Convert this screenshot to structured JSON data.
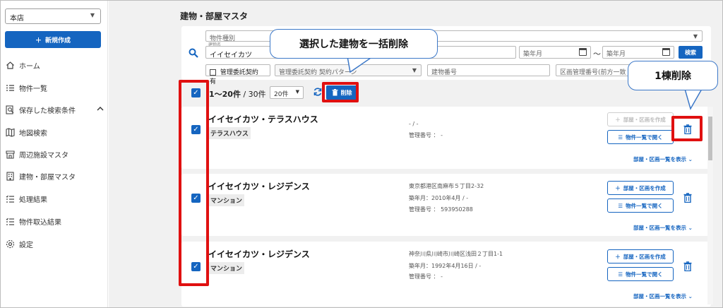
{
  "sidebar": {
    "store": "本店",
    "new_button": "新規作成",
    "items": [
      {
        "label": "ホーム",
        "icon": "home-icon"
      },
      {
        "label": "物件一覧",
        "icon": "list-icon"
      },
      {
        "label": "保存した検索条件",
        "icon": "saved-search-icon"
      },
      {
        "label": "地図検索",
        "icon": "map-icon"
      },
      {
        "label": "周辺施設マスタ",
        "icon": "store-icon"
      },
      {
        "label": "建物・部屋マスタ",
        "icon": "building-icon"
      },
      {
        "label": "処理結果",
        "icon": "checklist-icon"
      },
      {
        "label": "物件取込結果",
        "icon": "checklist-icon"
      },
      {
        "label": "設定",
        "icon": "gear-icon"
      }
    ]
  },
  "page": {
    "title": "建物・部屋マスタ"
  },
  "search": {
    "property_type_placeholder": "物件種別",
    "building_name_label": "建物名",
    "building_name_value": "イイセイカツ",
    "built_from_placeholder": "築年月",
    "range_sep": "〜",
    "built_to_placeholder": "築年月",
    "search_button": "検索",
    "mgmt_contract_label": "管理委託契約 有",
    "contract_pattern_placeholder": "管理委託契約 契約パターン",
    "building_number_placeholder": "建物番号",
    "section_number_placeholder": "区画管理番号(前方一致"
  },
  "toolbar": {
    "count_range": "1〜20件",
    "count_total": " / 30件",
    "per_page": "20件",
    "delete_button": "削除"
  },
  "cards": [
    {
      "name": "イイセイカツ・テラスハウス",
      "type": "テラスハウス",
      "address": "- / -",
      "built": "",
      "mgmt_no": "管理番号 ： -",
      "create_label": "部屋・区画を作成",
      "open_label": "物件一覧で開く",
      "expand_label": "部屋・区画一覧を表示"
    },
    {
      "name": "イイセイカツ・レジデンス",
      "type": "マンション",
      "address": "東京都港区南麻布５丁目2-32",
      "built": "築年月：2010年4月 / -",
      "mgmt_no": "管理番号 ： 593950288",
      "create_label": "部屋・区画を作成",
      "open_label": "物件一覧で開く",
      "expand_label": "部屋・区画一覧を表示"
    },
    {
      "name": "イイセイカツ・レジデンス",
      "type": "マンション",
      "address": "神奈川県川崎市川崎区浅田２丁目1-1",
      "built": "築年月：1992年4月16日 / -",
      "mgmt_no": "管理番号 ： -",
      "create_label": "部屋・区画を作成",
      "open_label": "物件一覧で開く",
      "expand_label": "部屋・区画一覧を表示"
    }
  ],
  "callouts": {
    "bulk_delete": "選択した建物を一括削除",
    "single_delete": "1棟削除"
  },
  "colors": {
    "accent": "#1565c0",
    "highlight": "#e01010"
  }
}
